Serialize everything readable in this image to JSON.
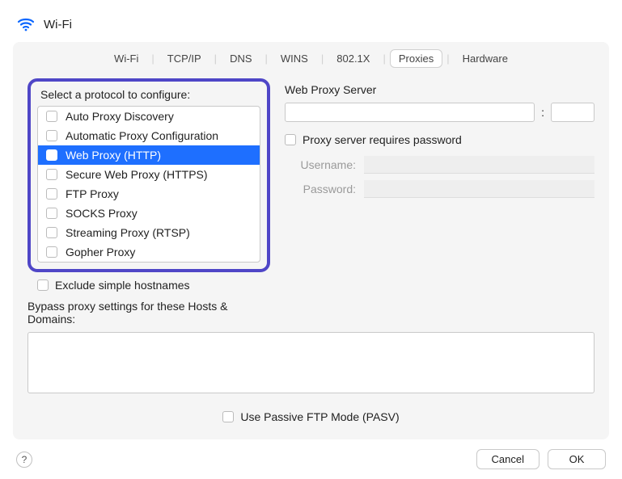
{
  "header": {
    "title": "Wi-Fi",
    "icon": "wifi-icon"
  },
  "tabs": {
    "items": [
      {
        "label": "Wi-Fi",
        "selected": false
      },
      {
        "label": "TCP/IP",
        "selected": false
      },
      {
        "label": "DNS",
        "selected": false
      },
      {
        "label": "WINS",
        "selected": false
      },
      {
        "label": "802.1X",
        "selected": false
      },
      {
        "label": "Proxies",
        "selected": true
      },
      {
        "label": "Hardware",
        "selected": false
      }
    ]
  },
  "left": {
    "select_label": "Select a protocol to configure:",
    "protocols": [
      {
        "label": "Auto Proxy Discovery",
        "checked": false,
        "selected": false
      },
      {
        "label": "Automatic Proxy Configuration",
        "checked": false,
        "selected": false
      },
      {
        "label": "Web Proxy (HTTP)",
        "checked": true,
        "selected": true
      },
      {
        "label": "Secure Web Proxy (HTTPS)",
        "checked": false,
        "selected": false
      },
      {
        "label": "FTP Proxy",
        "checked": false,
        "selected": false
      },
      {
        "label": "SOCKS Proxy",
        "checked": false,
        "selected": false
      },
      {
        "label": "Streaming Proxy (RTSP)",
        "checked": false,
        "selected": false
      },
      {
        "label": "Gopher Proxy",
        "checked": false,
        "selected": false
      }
    ],
    "exclude_label": "Exclude simple hostnames",
    "exclude_checked": false
  },
  "right": {
    "title": "Web Proxy Server",
    "server_value": "",
    "port_value": "",
    "auth_label": "Proxy server requires password",
    "auth_checked": false,
    "username_label": "Username:",
    "username_value": "",
    "password_label": "Password:",
    "password_value": ""
  },
  "bypass": {
    "label": "Bypass proxy settings for these Hosts & Domains:",
    "value": ""
  },
  "pasv": {
    "label": "Use Passive FTP Mode (PASV)",
    "checked": false
  },
  "footer": {
    "help": "?",
    "cancel": "Cancel",
    "ok": "OK"
  }
}
